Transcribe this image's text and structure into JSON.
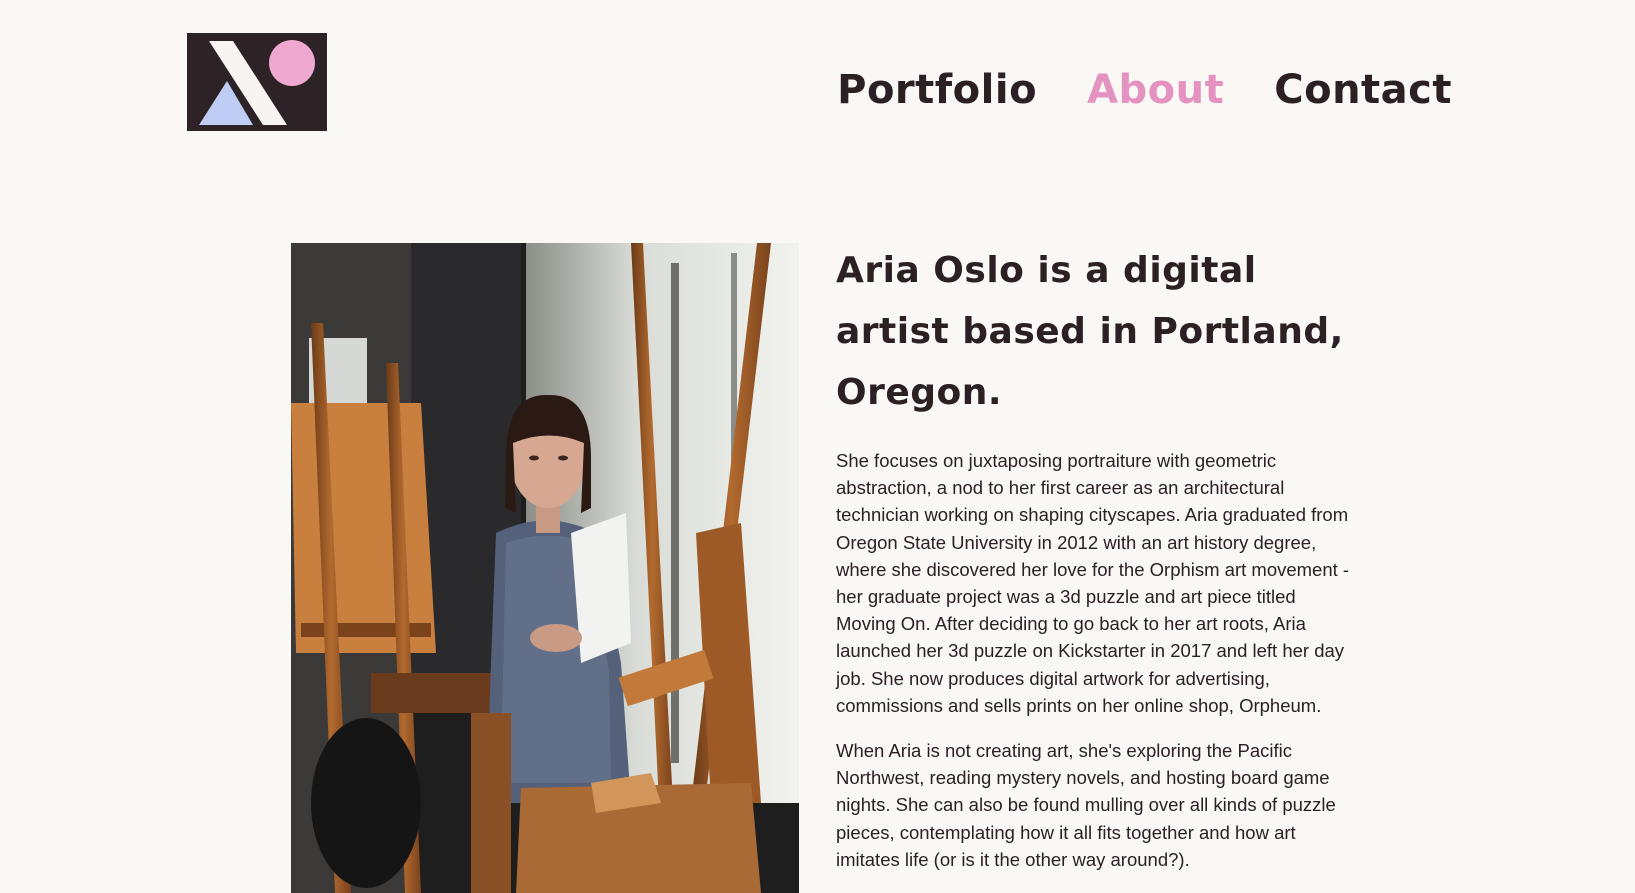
{
  "nav": {
    "items": [
      {
        "label": "Portfolio",
        "active": false
      },
      {
        "label": "About",
        "active": true
      },
      {
        "label": "Contact",
        "active": false
      }
    ]
  },
  "about": {
    "headline": "Aria Oslo is a digital artist based in Portland, Oregon.",
    "paragraphs": [
      "She focuses on juxtaposing portraiture with geometric abstraction, a nod to her first career as an architectural technician working on shaping cityscapes. Aria graduated from Oregon State University in 2012 with an art history degree, where she discovered her love for the Orphism art movement - her graduate project was a 3d puzzle and art piece titled Moving On. After deciding to go back to her art roots, Aria launched her 3d puzzle on Kickstarter in 2017 and left her day job. She now produces digital artwork for advertising, commissions and sells prints on her online shop, Orpheum.",
      "When Aria is not creating art, she's exploring the Pacific Northwest, reading mystery novels, and hosting board game nights. She can also be found mulling over all kinds of puzzle pieces, contemplating how it all fits together and how art imitates life (or is it the other way around?)."
    ]
  },
  "colors": {
    "background": "#faf8f5",
    "text": "#2b2124",
    "accent_pink": "#e492c0",
    "accent_blue": "#bfccf4",
    "logo_bg": "#2d2326"
  }
}
